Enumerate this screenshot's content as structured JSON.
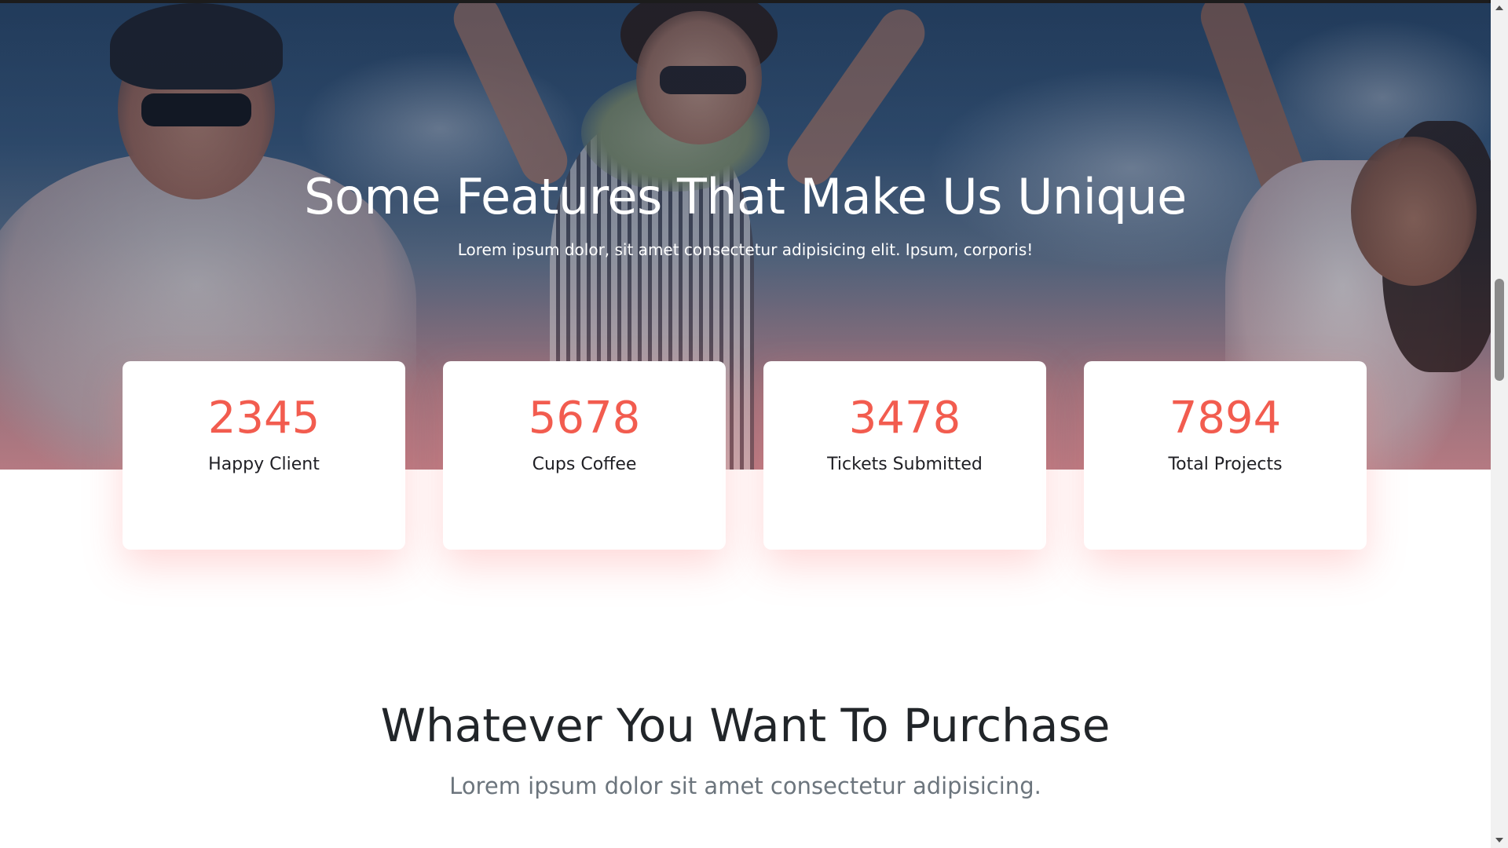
{
  "hero": {
    "title": "Some Features That Make Us Unique",
    "subtitle": "Lorem ipsum dolor, sit amet consectetur adipisicing elit. Ipsum, corporis!"
  },
  "stats": [
    {
      "value": "2345",
      "label": "Happy Client"
    },
    {
      "value": "5678",
      "label": "Cups Coffee"
    },
    {
      "value": "3478",
      "label": "Tickets Submitted"
    },
    {
      "value": "7894",
      "label": "Total Projects"
    }
  ],
  "purchase": {
    "title": "Whatever You Want To Purchase",
    "subtitle": "Lorem ipsum dolor sit amet consectetur adipisicing."
  },
  "colors": {
    "accent": "#f25c4f",
    "heading": "#212529",
    "muted": "#6c757d"
  },
  "icons": {
    "scroll_up": "arrow-up-icon",
    "scroll_down": "arrow-down-icon"
  }
}
